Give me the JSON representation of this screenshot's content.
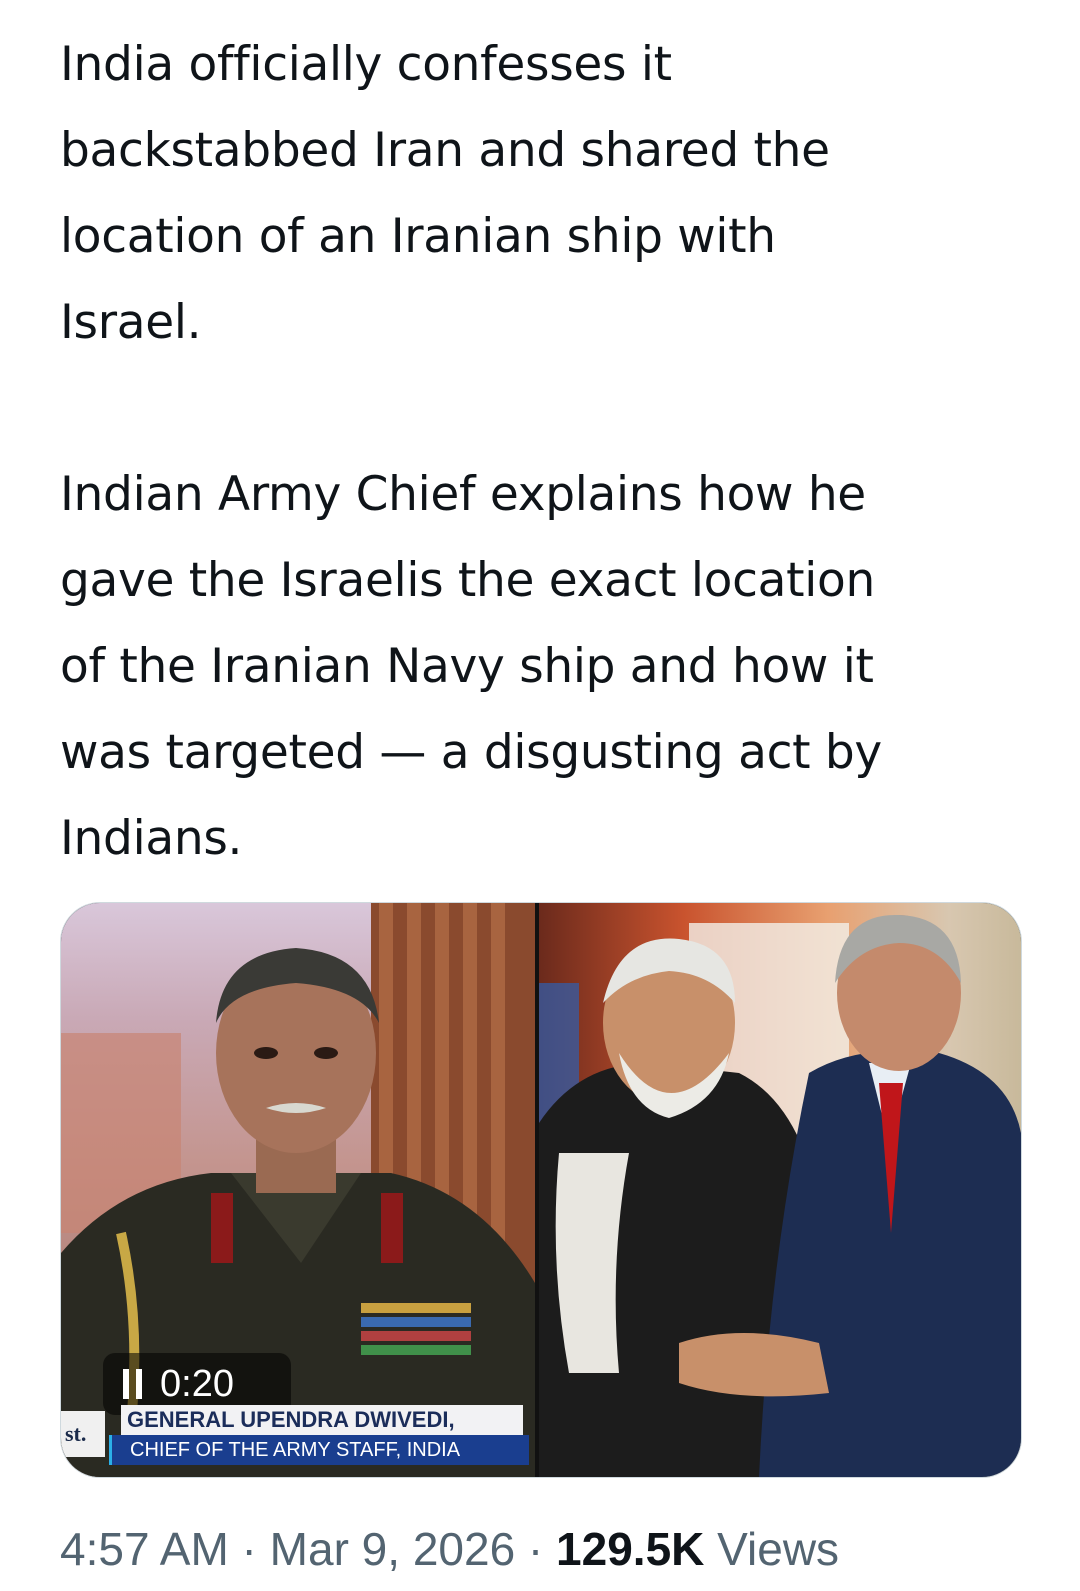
{
  "tweet": {
    "paragraph_1": "India officially confesses it\nbackstabbed Iran and shared the\nlocation of an Iranian ship with\nIsrael.",
    "paragraph_2": "Indian Army Chief explains how he\ngave the Israelis the exact location\nof the Iranian Navy ship and how it\nwas targeted — a disgusting act by\nIndians."
  },
  "media": {
    "video_time": "0:20",
    "channel_bug": "st.",
    "lower_third_name": "GENERAL UPENDRA DWIVEDI,",
    "lower_third_role": "CHIEF OF THE ARMY STAFF, INDIA",
    "icons": [
      "pause-icon"
    ]
  },
  "meta": {
    "time": "4:57 AM",
    "separator_1": " · ",
    "date": "Mar 9, 2026",
    "separator_2": " · ",
    "views_count": "129.5K",
    "views_label": " Views"
  },
  "colors": {
    "text": "#0f1419",
    "secondary_text": "#536471",
    "border": "#cfd9de",
    "lower_third_blue": "#1a3e8f"
  }
}
